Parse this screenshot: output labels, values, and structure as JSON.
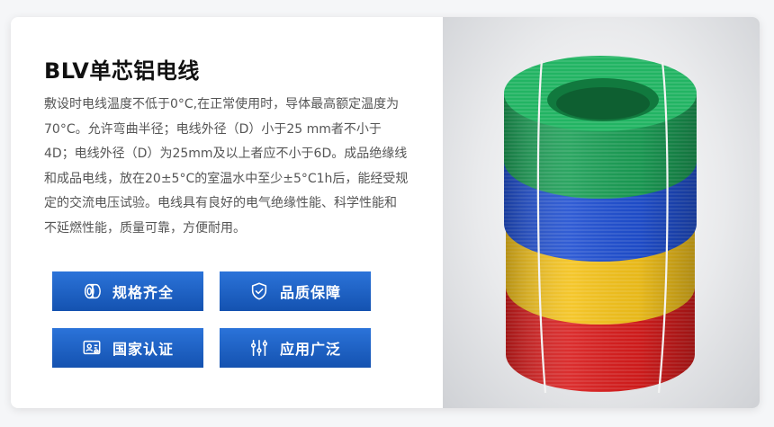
{
  "product": {
    "title": "BLV单芯铝电线",
    "description_lines": [
      "敷设时电线温度不低于0°C,在正常使用时，导体最高额定温度为",
      "70°C。允许弯曲半径；电线外径（D）小于25 mm者不小于",
      "4D；电线外径（D）为25mm及以上者应不小于6D。成品绝缘线",
      "和成品电线，放在20±5°C的室温水中至少±5°C1h后，能经受规",
      "定的交流电压试验。电线具有良好的电气绝缘性能、科学性能和",
      "不延燃性能，质量可靠，方便耐用。"
    ]
  },
  "features": [
    {
      "label": "规格齐全",
      "icon": "cable-reel-icon"
    },
    {
      "label": "品质保障",
      "icon": "shield-check-icon"
    },
    {
      "label": "国家认证",
      "icon": "certificate-icon"
    },
    {
      "label": "应用广泛",
      "icon": "sliders-icon"
    }
  ],
  "colors": {
    "button_top": "#2b73d9",
    "button_bottom": "#1452b0",
    "coil_green": "#1fa35a",
    "coil_blue": "#1f4fd1",
    "coil_yellow": "#f5c518",
    "coil_red": "#e02020"
  }
}
